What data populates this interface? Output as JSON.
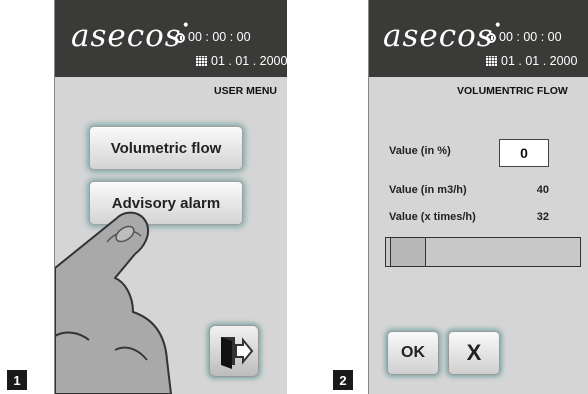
{
  "steps": [
    "1",
    "2"
  ],
  "brand": {
    "name": "asecos",
    "mark": "•"
  },
  "datetime": {
    "time": "00 : 00 : 00",
    "date": "01 . 01 . 2000"
  },
  "screen1": {
    "title": "USER MENU",
    "buttons": [
      "Volumetric flow",
      "Advisory alarm"
    ],
    "exit_icon": "exit-door-icon"
  },
  "screen2": {
    "title": "VOLUMENTRIC FLOW",
    "rows": [
      {
        "label": "Value (in %)",
        "value": "0"
      },
      {
        "label": "Value (in m3/h)",
        "value": "40"
      },
      {
        "label": "Value  (x times/h)",
        "value": "32"
      }
    ],
    "slider_level": 0,
    "ok_label": "OK",
    "cancel_label": "X"
  },
  "colors": {
    "header": "#3a3a38",
    "screen": "#d5d5d5",
    "button_glow": "#7fa8a8"
  }
}
